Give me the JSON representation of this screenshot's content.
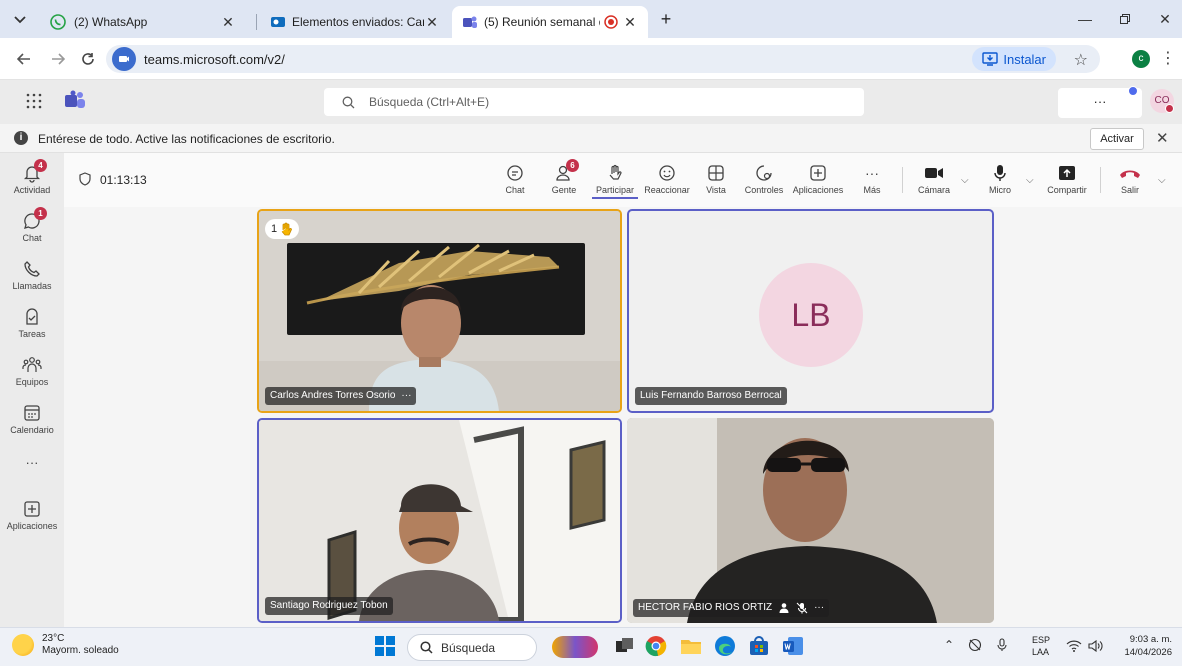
{
  "browser": {
    "tabs": [
      {
        "label": "(2) WhatsApp"
      },
      {
        "label": "Elementos enviados: Carlos And"
      },
      {
        "label": "(5) Reunión semanal de gru"
      }
    ],
    "url": "teams.microsoft.com/v2/",
    "install_label": "Instalar",
    "profile_initial": "c"
  },
  "teams": {
    "search_placeholder": "Búsqueda (Ctrl+Alt+E)",
    "more_label": "···",
    "avatar_initials": "CO"
  },
  "notification": {
    "text": "Entérese de todo. Active las notificaciones de escritorio.",
    "activate_label": "Activar"
  },
  "rail": [
    {
      "label": "Actividad",
      "badge": "4",
      "icon": "bell-icon"
    },
    {
      "label": "Chat",
      "badge": "1",
      "icon": "chat-icon"
    },
    {
      "label": "Llamadas",
      "icon": "phone-icon"
    },
    {
      "label": "Tareas",
      "icon": "tasks-icon"
    },
    {
      "label": "Equipos",
      "icon": "teams-icon"
    },
    {
      "label": "Calendario",
      "icon": "calendar-icon"
    },
    {
      "label": "···",
      "icon": "more-icon"
    },
    {
      "label": "Aplicaciones",
      "icon": "add-apps-icon"
    }
  ],
  "meeting": {
    "timer": "01:13:13",
    "controls": {
      "chat": "Chat",
      "people": "Gente",
      "people_badge": "6",
      "raise_hand": "Participar",
      "react": "Reaccionar",
      "view": "Vista",
      "controls": "Controles",
      "apps": "Aplicaciones",
      "more": "Más",
      "camera": "Cámara",
      "mic": "Micro",
      "share": "Compartir",
      "leave": "Salir"
    },
    "participants": [
      {
        "name": "Carlos Andres Torres Osorio",
        "raised_hand": "1",
        "more": "···"
      },
      {
        "name": "Luis Fernando Barroso Berrocal",
        "initials": "LB"
      },
      {
        "name": "Santiago Rodriguez Tobon"
      },
      {
        "name": "HECTOR FABIO RIOS ORTIZ",
        "more": "···"
      }
    ]
  },
  "taskbar": {
    "temperature": "23°C",
    "weather": "Mayorm. soleado",
    "search": "Búsqueda",
    "lang_top": "ESP",
    "lang_bottom": "LAA",
    "time": "9:03 a. m.",
    "date": "14/04/2026"
  },
  "colors": {
    "accent": "#5b5fc7",
    "speaker_border": "#e8a317",
    "badge": "#c4314b"
  }
}
